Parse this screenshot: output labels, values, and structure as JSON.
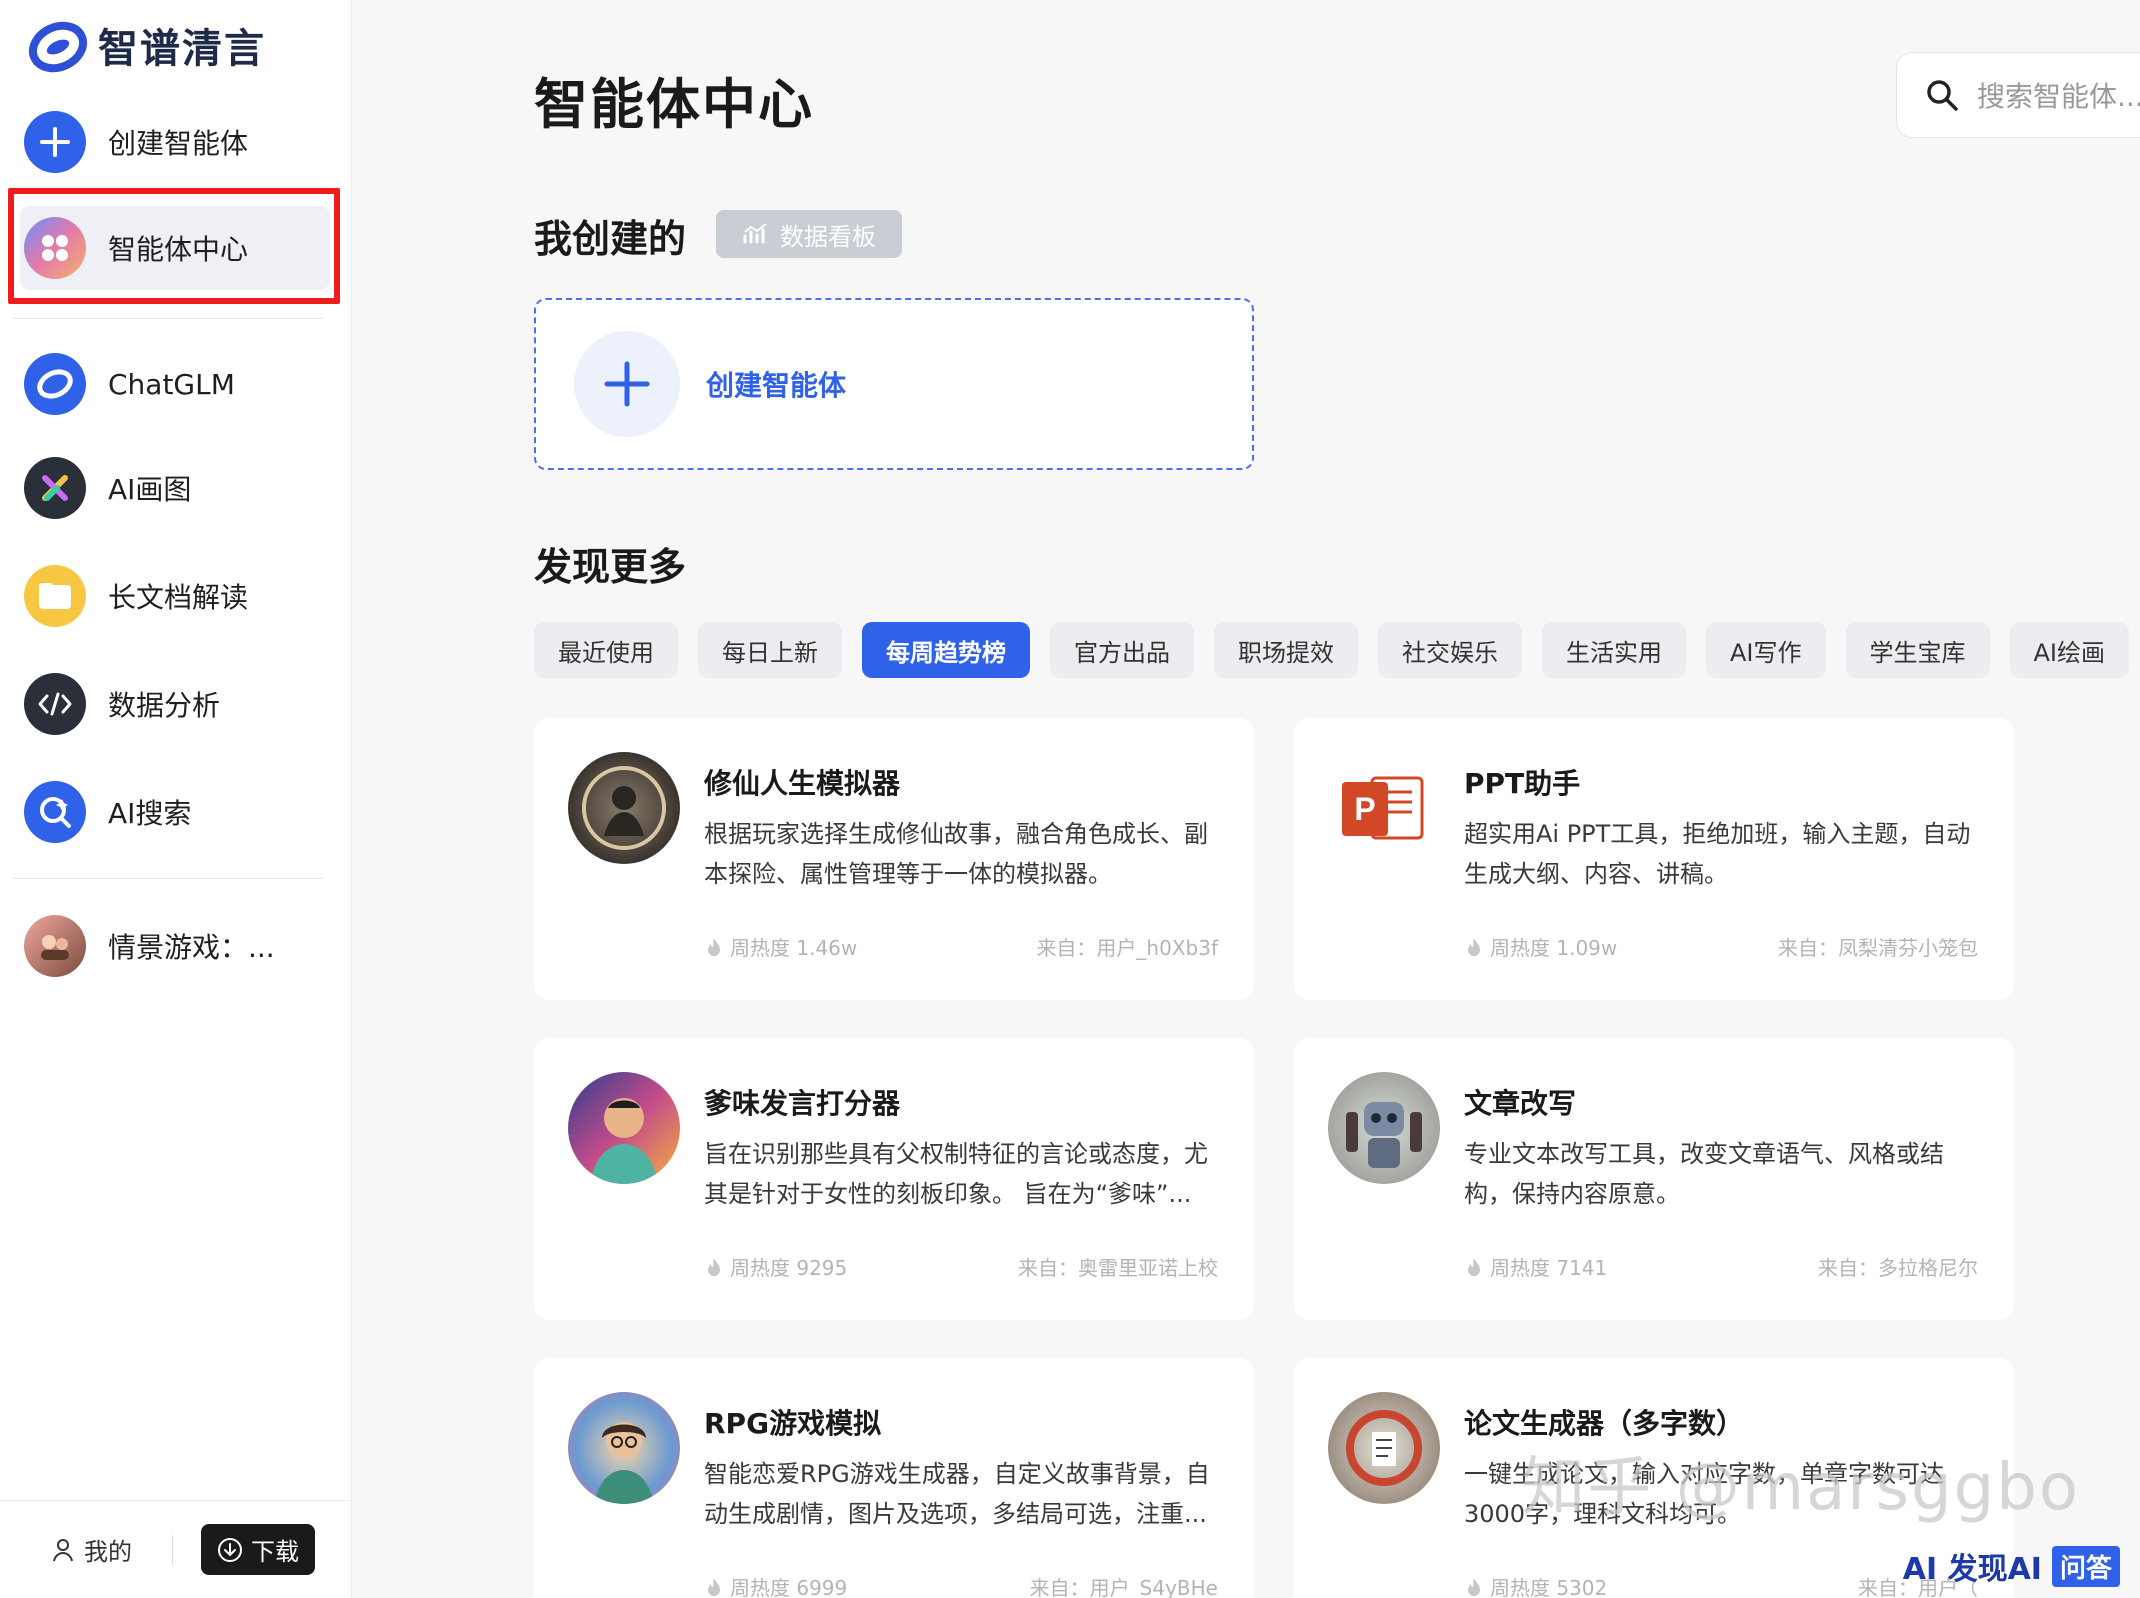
{
  "brand": {
    "name": "智谱清言"
  },
  "sidebar": {
    "items": [
      {
        "label": "创建智能体"
      },
      {
        "label": "智能体中心"
      },
      {
        "label": "ChatGLM"
      },
      {
        "label": "AI画图"
      },
      {
        "label": "长文档解读"
      },
      {
        "label": "数据分析"
      },
      {
        "label": "AI搜索"
      },
      {
        "label": "情景游戏：..."
      }
    ],
    "footer": {
      "me_label": "我的",
      "download_label": "下载"
    }
  },
  "main": {
    "title": "智能体中心",
    "search_placeholder": "搜索智能体...",
    "my_created": {
      "title": "我创建的",
      "dashboard_label": "数据看板",
      "create_label": "创建智能体"
    },
    "discover": {
      "title": "发现更多",
      "tabs": [
        "最近使用",
        "每日上新",
        "每周趋势榜",
        "官方出品",
        "职场提效",
        "社交娱乐",
        "生活实用",
        "AI写作",
        "学生宝库",
        "AI绘画"
      ],
      "active_tab": "每周趋势榜",
      "cards": [
        {
          "name": "修仙人生模拟器",
          "desc": "根据玩家选择生成修仙故事，融合角色成长、副本探险、属性管理等于一体的模拟器。",
          "heat": "周热度 1.46w",
          "source": "来自：用户_h0Xb3f"
        },
        {
          "name": "PPT助手",
          "desc": "超实用Ai PPT工具，拒绝加班，输入主题，自动生成大纲、内容、讲稿。",
          "heat": "周热度 1.09w",
          "source": "来自：凤梨清芬小笼包"
        },
        {
          "name": "爹味发言打分器",
          "desc": "旨在识别那些具有父权制特征的言论或态度，尤其是针对于女性的刻板印象。 旨在为“爹味”...",
          "heat": "周热度 9295",
          "source": "来自：奥雷里亚诺上校"
        },
        {
          "name": "文章改写",
          "desc": "专业文本改写工具，改变文章语气、风格或结构，保持内容原意。",
          "heat": "周热度 7141",
          "source": "来自：多拉格尼尔"
        },
        {
          "name": "RPG游戏模拟",
          "desc": "智能恋爱RPG游戏生成器，自定义故事背景，自动生成剧情，图片及选项，多结局可选，注重...",
          "heat": "周热度 6999",
          "source": "来自：用户_S4yBHe"
        },
        {
          "name": "论文生成器（多字数）",
          "desc": "一键生成论文，输入对应字数，单章字数可达3000字，理科文科均可。",
          "heat": "周热度 5302",
          "source": "来自：用户（"
        }
      ]
    }
  },
  "overlay": {
    "watermark": "知乎 @marsggbo",
    "badge_ai": "AI 发现AI",
    "badge_qa": "问答"
  },
  "colors": {
    "accent": "#2f62e8",
    "highlight": "#ee1c1c"
  }
}
